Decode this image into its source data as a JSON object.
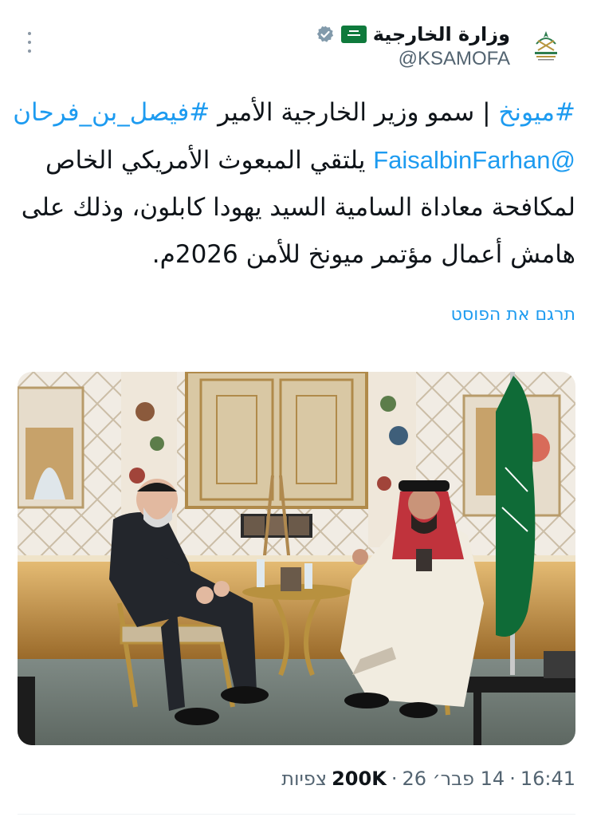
{
  "author": {
    "display_name": "وزارة الخارجية",
    "handle": "@KSAMOFA",
    "avatar_icon": "ministry-emblem-icon",
    "flag_icon": "saudi-flag-icon",
    "verified_icon": "gray-verified-badge-icon"
  },
  "tweet": {
    "line1_tag1": "#ميونخ",
    "line1_text": " | سمو وزير الخارجية الأمير ",
    "line1_tag2": "#فيصل_بن_فرحان",
    "line2_mention": "@FaisalbinFarhan",
    "line2_text": " يلتقي المبعوث الأمريكي الخاص",
    "line3": "لمكافحة معاداة السامية السيد يهودا كابلون، وذلك على",
    "line4": "هامش أعمال مؤتمر ميونخ للأمن 2026م."
  },
  "translate_label": "תרגם את הפוסט",
  "photo_alt": "photo",
  "meta": {
    "time": "16:41",
    "sep1": "·",
    "date": "14 פבר׳ 26",
    "sep2": "·",
    "views_count": "200K",
    "views_label": "צפיות"
  },
  "colors": {
    "link": "#1d9bf0",
    "secondary_text": "#536471",
    "primary_text": "#0f1419"
  }
}
